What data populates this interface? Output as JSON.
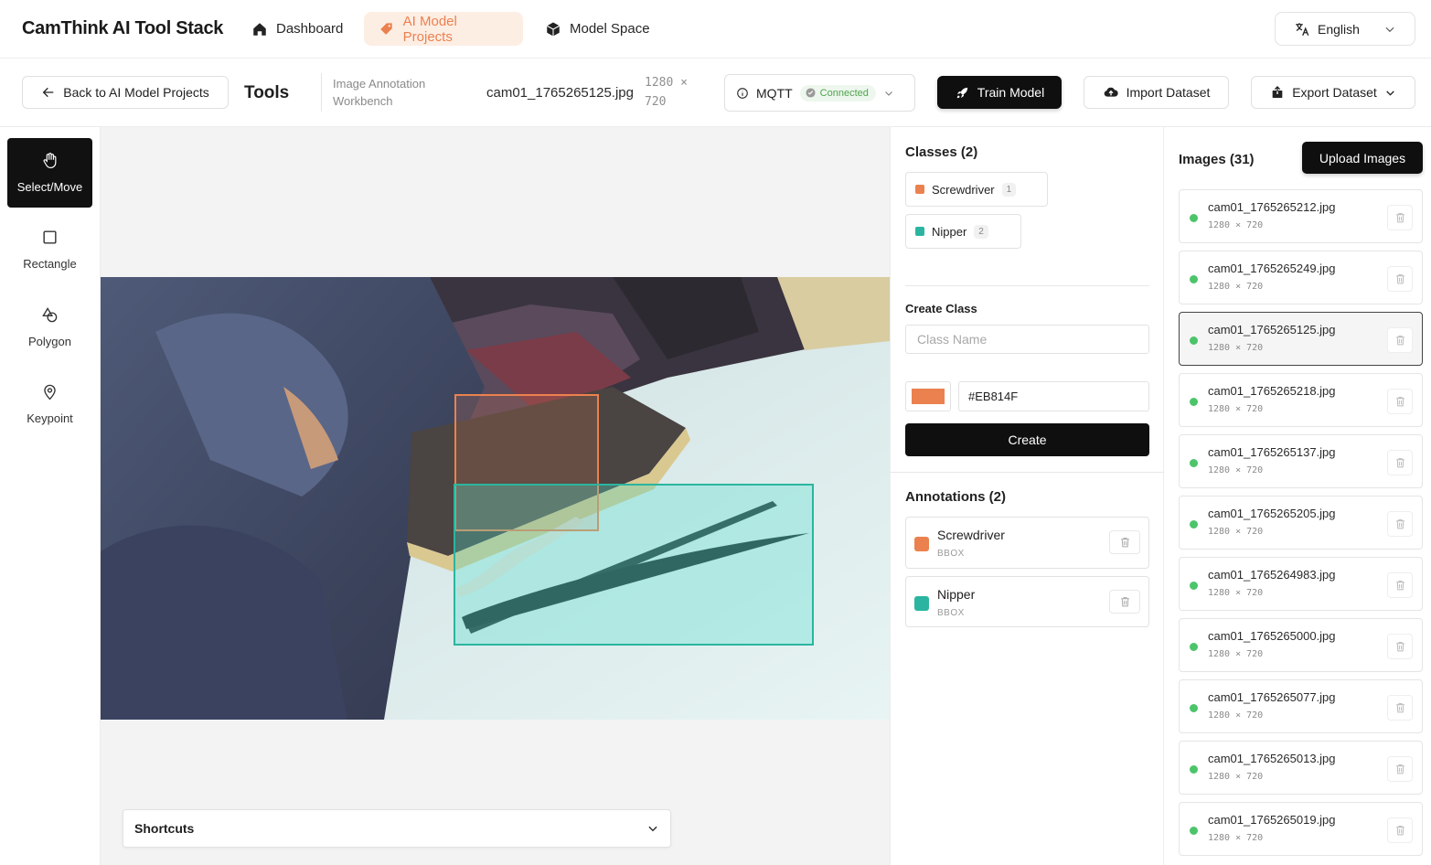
{
  "app": {
    "title": "CamThink AI Tool Stack"
  },
  "nav": {
    "items": [
      {
        "label": "Dashboard",
        "icon": "home-icon"
      },
      {
        "label": "AI Model Projects",
        "icon": "tag-icon",
        "active": true
      },
      {
        "label": "Model Space",
        "icon": "cube-icon"
      }
    ],
    "language": "English"
  },
  "toolbar": {
    "back_label": "Back to AI Model Projects",
    "tools_title": "Tools",
    "workbench_label": "Image Annotation Workbench",
    "filename": "cam01_1765265125.jpg",
    "dimensions": "1280 × 720",
    "mqtt_label": "MQTT",
    "mqtt_status": "Connected",
    "train_label": "Train Model",
    "import_label": "Import Dataset",
    "export_label": "Export Dataset"
  },
  "tools": [
    {
      "label": "Select/Move",
      "icon": "hand-icon",
      "active": true
    },
    {
      "label": "Rectangle",
      "icon": "rectangle-icon"
    },
    {
      "label": "Polygon",
      "icon": "polygon-icon"
    },
    {
      "label": "Keypoint",
      "icon": "map-pin-icon"
    }
  ],
  "canvas": {
    "shortcuts_label": "Shortcuts"
  },
  "classes": {
    "title": "Classes (2)",
    "items": [
      {
        "name": "Screwdriver",
        "count": "1",
        "color": "#EB814F"
      },
      {
        "name": "Nipper",
        "count": "2",
        "color": "#2BB5A0"
      }
    ]
  },
  "create_class": {
    "title": "Create Class",
    "placeholder": "Class Name",
    "color_value": "#EB814F",
    "button_label": "Create"
  },
  "annotations": {
    "title": "Annotations (2)",
    "items": [
      {
        "name": "Screwdriver",
        "type": "BBOX",
        "color": "#EB814F"
      },
      {
        "name": "Nipper",
        "type": "BBOX",
        "color": "#2BB5A0"
      }
    ]
  },
  "images": {
    "title": "Images (31)",
    "upload_label": "Upload Images",
    "items": [
      {
        "name": "cam01_1765265212.jpg",
        "dims": "1280 × 720"
      },
      {
        "name": "cam01_1765265249.jpg",
        "dims": "1280 × 720"
      },
      {
        "name": "cam01_1765265125.jpg",
        "dims": "1280 × 720",
        "selected": true
      },
      {
        "name": "cam01_1765265218.jpg",
        "dims": "1280 × 720"
      },
      {
        "name": "cam01_1765265137.jpg",
        "dims": "1280 × 720"
      },
      {
        "name": "cam01_1765265205.jpg",
        "dims": "1280 × 720"
      },
      {
        "name": "cam01_1765264983.jpg",
        "dims": "1280 × 720"
      },
      {
        "name": "cam01_1765265000.jpg",
        "dims": "1280 × 720"
      },
      {
        "name": "cam01_1765265077.jpg",
        "dims": "1280 × 720"
      },
      {
        "name": "cam01_1765265013.jpg",
        "dims": "1280 × 720"
      },
      {
        "name": "cam01_1765265019.jpg",
        "dims": "1280 × 720"
      }
    ]
  },
  "colors": {
    "accent": "#EB814F",
    "teal": "#2BB5A0",
    "dark": "#0F0F0F",
    "connected": "#4EA44E"
  }
}
